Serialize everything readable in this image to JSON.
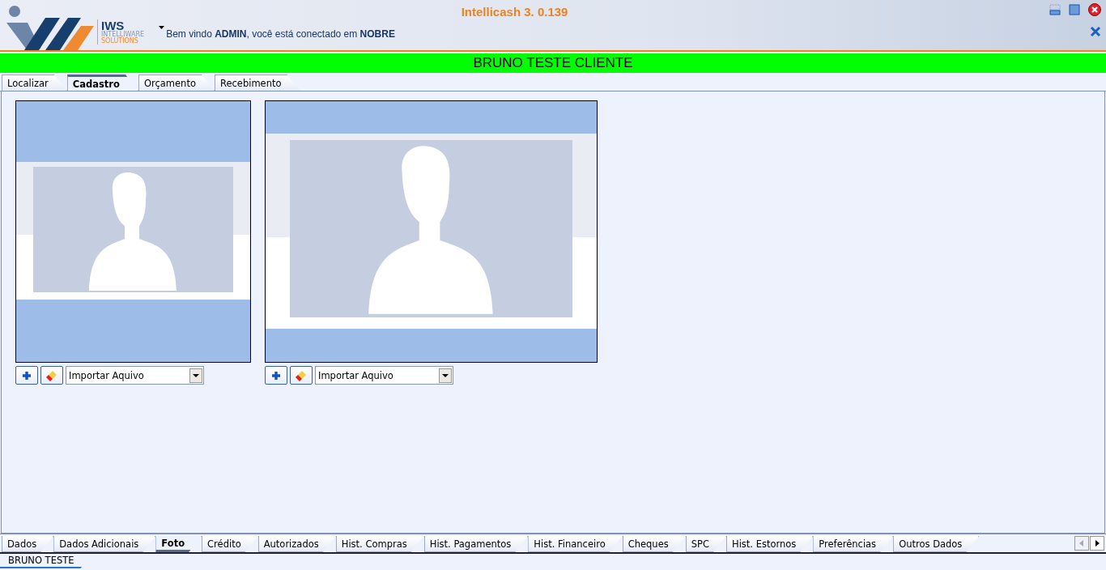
{
  "window": {
    "title": "Intellicash 3. 0.139"
  },
  "logo": {
    "name": "IWS",
    "line_1": "INTELLIWARE",
    "line_2": "SOLUTIONS"
  },
  "welcome": "Bem vindo **ADMIN**, você está conectado em **NOBRE**",
  "client_banner": "BRUNO TESTE CLIENTE",
  "top_tabs": [
    {
      "label": "Localizar",
      "selected": false
    },
    {
      "label": "Cadastro",
      "selected": true
    },
    {
      "label": "Orçamento",
      "selected": false
    },
    {
      "label": "Recebimento",
      "selected": false
    }
  ],
  "photos": [
    {
      "source": "Importar Aquivo"
    },
    {
      "source": "Importar Aquivo"
    }
  ],
  "bottom_tabs": [
    {
      "label": "Dados",
      "selected": false
    },
    {
      "label": "Dados Adicionais",
      "selected": false
    },
    {
      "label": "Foto",
      "selected": true
    },
    {
      "label": "Crédito",
      "selected": false
    },
    {
      "label": "Autorizados",
      "selected": false
    },
    {
      "label": "Hist. Compras",
      "selected": false
    },
    {
      "label": "Hist. Pagamentos",
      "selected": false
    },
    {
      "label": "Hist. Financeiro",
      "selected": false
    },
    {
      "label": "Cheques",
      "selected": false
    },
    {
      "label": "SPC",
      "selected": false
    },
    {
      "label": "Hist. Estornos",
      "selected": false
    },
    {
      "label": "Preferências",
      "selected": false
    },
    {
      "label": "Outros Dados",
      "selected": false
    }
  ],
  "status_tabs": [
    {
      "label": "BRUNO TESTE",
      "selected": true
    }
  ]
}
